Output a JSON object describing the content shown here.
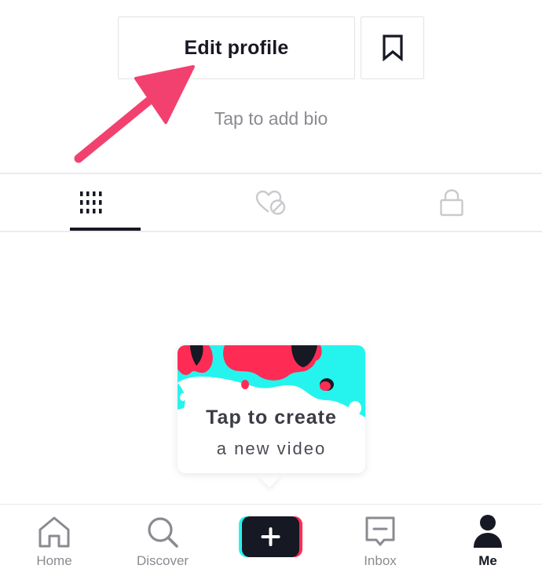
{
  "profile": {
    "edit_profile_label": "Edit profile",
    "bio_placeholder": "Tap to add bio"
  },
  "tabs": {
    "selected": "videos",
    "items": [
      {
        "name": "videos",
        "icon": "grid-icon"
      },
      {
        "name": "liked",
        "icon": "heart-hidden-icon"
      },
      {
        "name": "private",
        "icon": "lock-icon"
      }
    ]
  },
  "create_card": {
    "title": "Tap to create",
    "subtitle": "a new video"
  },
  "bottom_nav": {
    "home": "Home",
    "discover": "Discover",
    "inbox": "Inbox",
    "me": "Me",
    "active": "Me"
  },
  "colors": {
    "accent_pink": "#fe2c55",
    "accent_cyan": "#25f4ee",
    "annotation_arrow": "#f2416e",
    "text_primary": "#161823",
    "text_secondary": "#8a8b91"
  }
}
